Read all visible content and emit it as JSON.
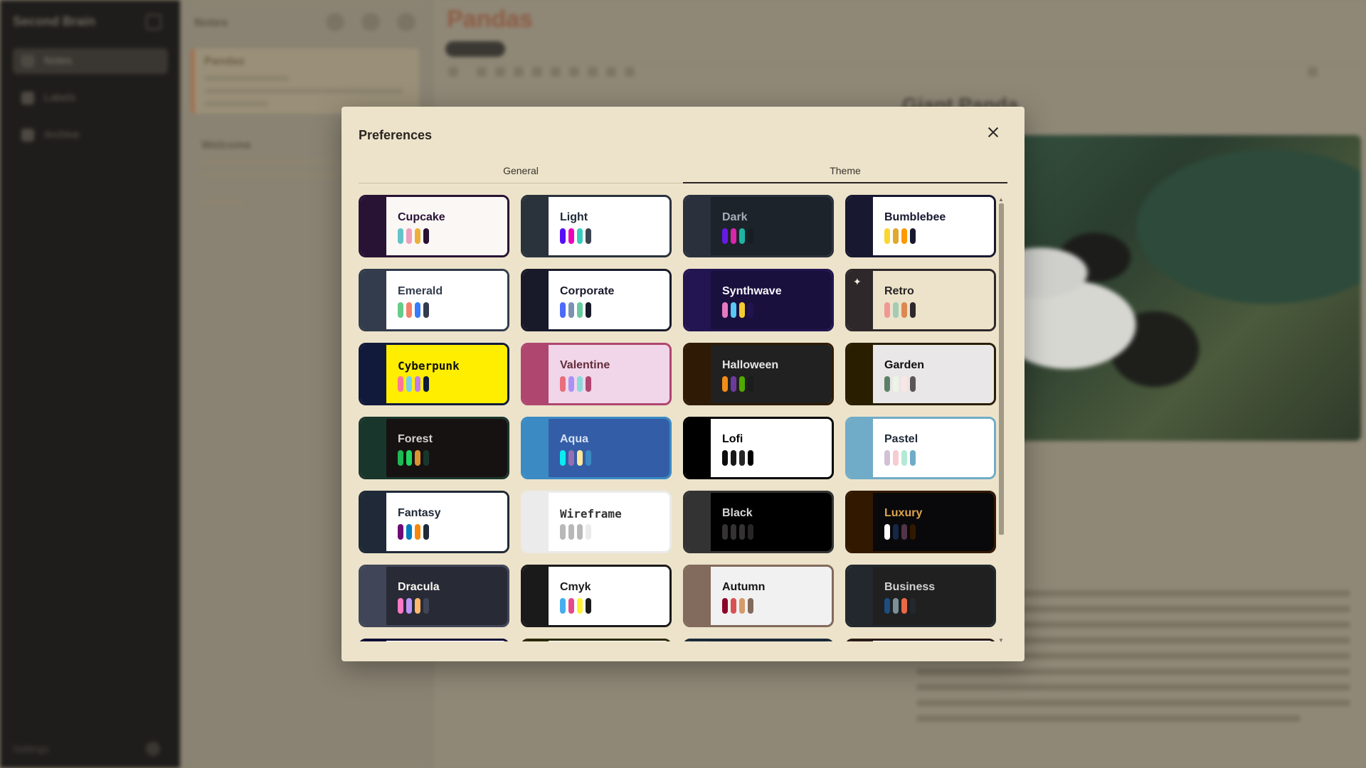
{
  "background_app": {
    "title": "Second Brain",
    "nav": [
      {
        "label": "Notes",
        "icon": "note-icon"
      },
      {
        "label": "Labels",
        "icon": "tag-icon"
      },
      {
        "label": "Archive",
        "icon": "archive-icon"
      }
    ],
    "footer_label": "Settings",
    "notes_header": "Notes",
    "notes": [
      {
        "title": "Pandas"
      },
      {
        "title": "Welcome"
      }
    ],
    "editor_title": "Pandas",
    "editor_heading": "Giant Panda"
  },
  "modal": {
    "title": "Preferences",
    "tabs": [
      {
        "label": "General",
        "active": false
      },
      {
        "label": "Theme",
        "active": true
      }
    ],
    "themes": [
      {
        "name": "Cupcake",
        "strip": "#291334",
        "bg": "#faf7f5",
        "text": "#291334",
        "border": "#291334",
        "swatches": [
          "#65c3c8",
          "#ef9fbc",
          "#eeaf3a",
          "#291334"
        ]
      },
      {
        "name": "Light",
        "strip": "#2a323c",
        "bg": "#ffffff",
        "text": "#1f2937",
        "border": "#2a323c",
        "swatches": [
          "#570df8",
          "#f000b8",
          "#37cdbe",
          "#3d4451"
        ]
      },
      {
        "name": "Dark",
        "strip": "#2a303c",
        "bg": "#1d232a",
        "text": "#a6adba",
        "border": "#2a303c",
        "swatches": [
          "#661ae6",
          "#d926aa",
          "#1fb2a5",
          "#191d24"
        ]
      },
      {
        "name": "Bumblebee",
        "strip": "#181830",
        "bg": "#ffffff",
        "text": "#181830",
        "border": "#181830",
        "swatches": [
          "#f9d72f",
          "#e0a82e",
          "#ff9900",
          "#181830"
        ]
      },
      {
        "name": "Emerald",
        "strip": "#333c4d",
        "bg": "#ffffff",
        "text": "#333c4d",
        "border": "#333c4d",
        "swatches": [
          "#66cc8a",
          "#f68067",
          "#377cfb",
          "#333c4d"
        ]
      },
      {
        "name": "Corporate",
        "strip": "#181a2a",
        "bg": "#ffffff",
        "text": "#181a2a",
        "border": "#181a2a",
        "swatches": [
          "#4b6bfb",
          "#7b92b2",
          "#67cba0",
          "#181a2a"
        ]
      },
      {
        "name": "Synthwave",
        "strip": "#221551",
        "bg": "#1a103d",
        "text": "#f9f7fd",
        "border": "#221551",
        "swatches": [
          "#e779c1",
          "#58c7f3",
          "#f3cc30",
          "#20134e"
        ]
      },
      {
        "name": "Retro",
        "strip": "#2e282a",
        "bg": "#ece3ca",
        "text": "#282425",
        "border": "#2e282a",
        "swatches": [
          "#ef9995",
          "#a4cbb4",
          "#dc8850",
          "#2e282a"
        ],
        "spark": true
      },
      {
        "name": "Cyberpunk",
        "strip": "#111a3b",
        "bg": "#ffee00",
        "text": "#111111",
        "border": "#111a3b",
        "swatches": [
          "#ff7598",
          "#75d1f0",
          "#c07eec",
          "#111a3b"
        ]
      },
      {
        "name": "Valentine",
        "strip": "#af4670",
        "bg": "#f0d6e8",
        "text": "#632c3b",
        "border": "#af4670",
        "swatches": [
          "#e96d7b",
          "#a991f7",
          "#88dbdd",
          "#af4670"
        ]
      },
      {
        "name": "Halloween",
        "strip": "#2f1b05",
        "bg": "#212121",
        "text": "#e6e6e6",
        "border": "#2f1b05",
        "swatches": [
          "#f28c18",
          "#6d3a9c",
          "#51a800",
          "#1b1d1d"
        ]
      },
      {
        "name": "Garden",
        "strip": "#291e00",
        "bg": "#e9e7e7",
        "text": "#100f0f",
        "border": "#291e00",
        "swatches": [
          "#5c7f67",
          "#ecf4e7",
          "#fae5e5",
          "#5d5656"
        ]
      },
      {
        "name": "Forest",
        "strip": "#19362d",
        "bg": "#171212",
        "text": "#d4d1d1",
        "border": "#19362d",
        "swatches": [
          "#1eb854",
          "#1fd65f",
          "#d99330",
          "#19362d"
        ]
      },
      {
        "name": "Aqua",
        "strip": "#3b8ac4",
        "bg": "#345da7",
        "text": "#d4e3f5",
        "border": "#3b8ac4",
        "swatches": [
          "#09ecf3",
          "#966fb3",
          "#ffe999",
          "#3b8ac4"
        ]
      },
      {
        "name": "Lofi",
        "strip": "#000000",
        "bg": "#ffffff",
        "text": "#000000",
        "border": "#000000",
        "swatches": [
          "#0d0d0d",
          "#1a1919",
          "#262626",
          "#000000"
        ]
      },
      {
        "name": "Pastel",
        "strip": "#70acc7",
        "bg": "#ffffff",
        "text": "#1f2937",
        "border": "#70acc7",
        "swatches": [
          "#d1c1d7",
          "#f6cbd1",
          "#b4e9d6",
          "#70acc7"
        ]
      },
      {
        "name": "Fantasy",
        "strip": "#1f2937",
        "bg": "#ffffff",
        "text": "#1f2937",
        "border": "#1f2937",
        "swatches": [
          "#6e0b75",
          "#007ebd",
          "#f8860d",
          "#1f2937"
        ]
      },
      {
        "name": "Wireframe",
        "strip": "#ebebeb",
        "bg": "#ffffff",
        "text": "#333333",
        "border": "#ebebeb",
        "swatches": [
          "#b8b8b8",
          "#b8b8b8",
          "#b8b8b8",
          "#ebebeb"
        ]
      },
      {
        "name": "Black",
        "strip": "#333333",
        "bg": "#000000",
        "text": "#d6d6d6",
        "border": "#333333",
        "swatches": [
          "#343232",
          "#343232",
          "#343232",
          "#272626"
        ]
      },
      {
        "name": "Luxury",
        "strip": "#331800",
        "bg": "#09090b",
        "text": "#dca54c",
        "border": "#331800",
        "swatches": [
          "#ffffff",
          "#152747",
          "#513448",
          "#331800"
        ]
      },
      {
        "name": "Dracula",
        "strip": "#414558",
        "bg": "#282a36",
        "text": "#f8f8f2",
        "border": "#414558",
        "swatches": [
          "#ff79c6",
          "#bd93f9",
          "#ffb86c",
          "#414558"
        ]
      },
      {
        "name": "Cmyk",
        "strip": "#1a1a1a",
        "bg": "#ffffff",
        "text": "#1a1a1a",
        "border": "#1a1a1a",
        "swatches": [
          "#45aeee",
          "#e8488a",
          "#fff232",
          "#1a1a1a"
        ]
      },
      {
        "name": "Autumn",
        "strip": "#826a5c",
        "bg": "#f1f1f1",
        "text": "#141414",
        "border": "#826a5c",
        "swatches": [
          "#8c0327",
          "#d85251",
          "#d59b6a",
          "#826a5c"
        ]
      },
      {
        "name": "Business",
        "strip": "#23282e",
        "bg": "#202020",
        "text": "#d1d1d1",
        "border": "#23282e",
        "swatches": [
          "#1c4e80",
          "#7c909a",
          "#ea6947",
          "#23282e"
        ]
      },
      {
        "name": "",
        "strip": "#0f0b36",
        "bg": "#ffffff",
        "text": "#0f0b36",
        "border": "#0f0b36",
        "swatches": []
      },
      {
        "name": "",
        "strip": "#2a2a05",
        "bg": "#ffffff",
        "text": "#2a2a05",
        "border": "#2a2a05",
        "swatches": []
      },
      {
        "name": "",
        "strip": "#1b2a3a",
        "bg": "#0f1b2a",
        "text": "#ffffff",
        "border": "#1b2a3a",
        "swatches": []
      },
      {
        "name": "",
        "strip": "#2a1a14",
        "bg": "#ffffff",
        "text": "#2a1a14",
        "border": "#2a1a14",
        "swatches": []
      }
    ]
  }
}
